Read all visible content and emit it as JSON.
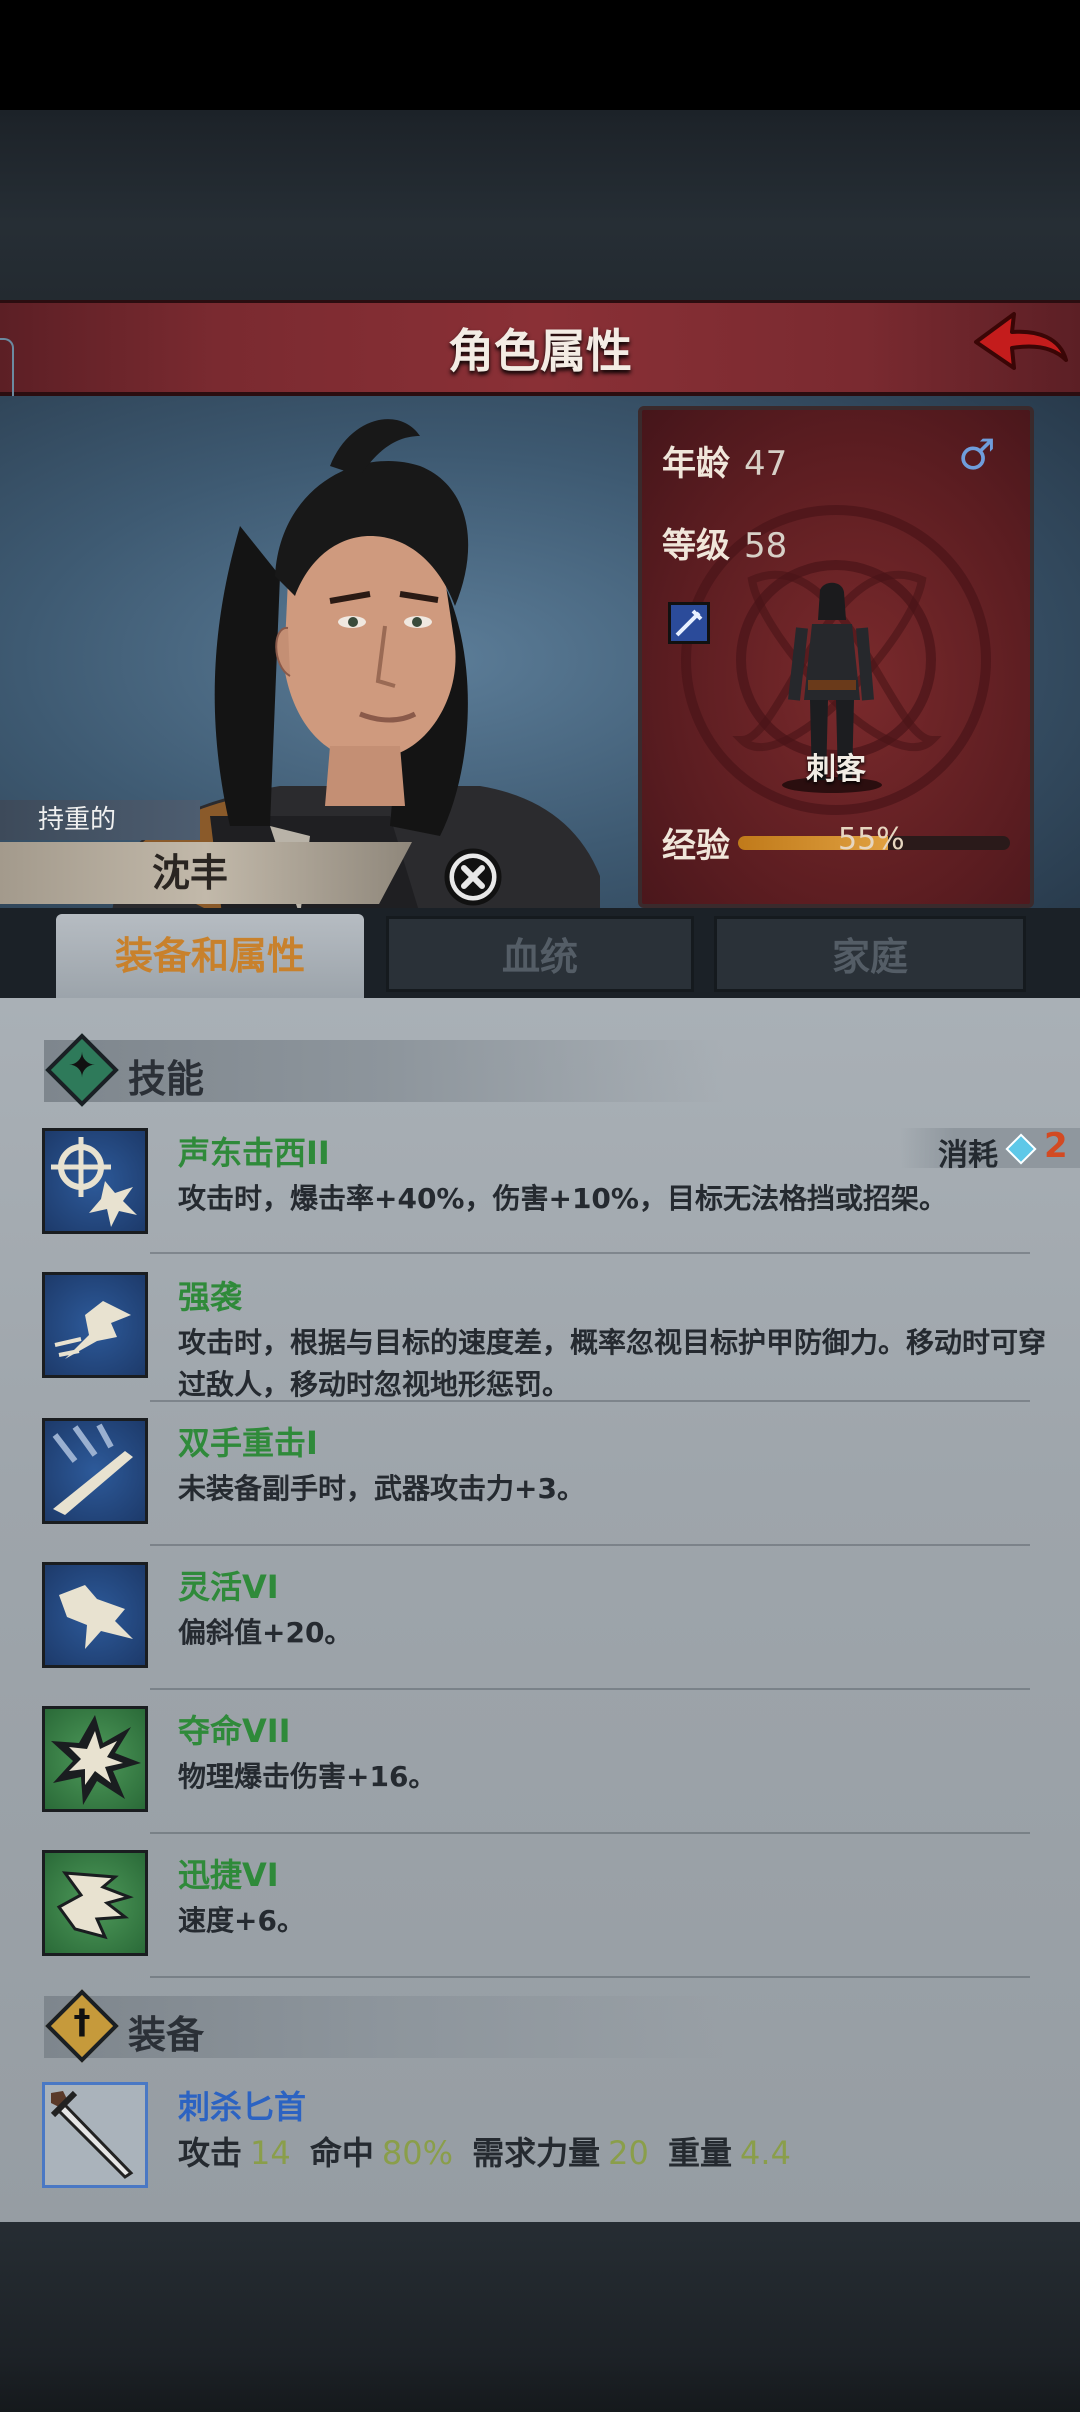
{
  "header": {
    "title": "角色属性"
  },
  "character": {
    "trait": "持重的",
    "name": "沈丰",
    "age_label": "年龄",
    "age": "47",
    "level_label": "等级",
    "level": "58",
    "gender_icon": "♂",
    "class": "刺客",
    "exp_label": "经验",
    "exp_percent": "55%",
    "exp_fraction": 0.55
  },
  "tabs": [
    {
      "label": "装备和属性",
      "active": true
    },
    {
      "label": "血统",
      "active": false
    },
    {
      "label": "家庭",
      "active": false
    }
  ],
  "skills_section": {
    "title": "技能"
  },
  "cost": {
    "label": "消耗",
    "value": "2"
  },
  "skills": [
    {
      "name": "声东击西II",
      "desc": "攻击时，爆击率+40%，伤害+10%，目标无法格挡或招架。",
      "icon": "target-burst-icon"
    },
    {
      "name": "强袭",
      "desc": "攻击时，根据与目标的速度差，概率忽视目标护甲防御力。移动时可穿过敌人，移动时忽视地形惩罚。",
      "icon": "charge-icon"
    },
    {
      "name": "双手重击I",
      "desc": "未装备副手时，武器攻击力+3。",
      "icon": "blade-strike-icon"
    },
    {
      "name": "灵活VI",
      "desc": "偏斜值+20。",
      "icon": "agility-icon"
    },
    {
      "name": "夺命VII",
      "desc": "物理爆击伤害+16。",
      "icon": "critical-star-icon"
    },
    {
      "name": "迅捷VI",
      "desc": "速度+6。",
      "icon": "swift-wing-icon"
    }
  ],
  "equipment_section": {
    "title": "装备"
  },
  "equipment": [
    {
      "name": "刺杀匕首",
      "icon": "dagger-icon",
      "stats": [
        {
          "label": "攻击",
          "value": "14"
        },
        {
          "label": "命中",
          "value": "80%"
        },
        {
          "label": "需求力量",
          "value": "20"
        },
        {
          "label": "重量",
          "value": "4.4"
        }
      ]
    }
  ],
  "colors": {
    "header_red": "#7a2a30",
    "skill_name_green": "#2f8a3a",
    "equip_name_blue": "#2c63c2",
    "active_tab_orange": "#c8812c",
    "cost_red": "#d34a22"
  }
}
